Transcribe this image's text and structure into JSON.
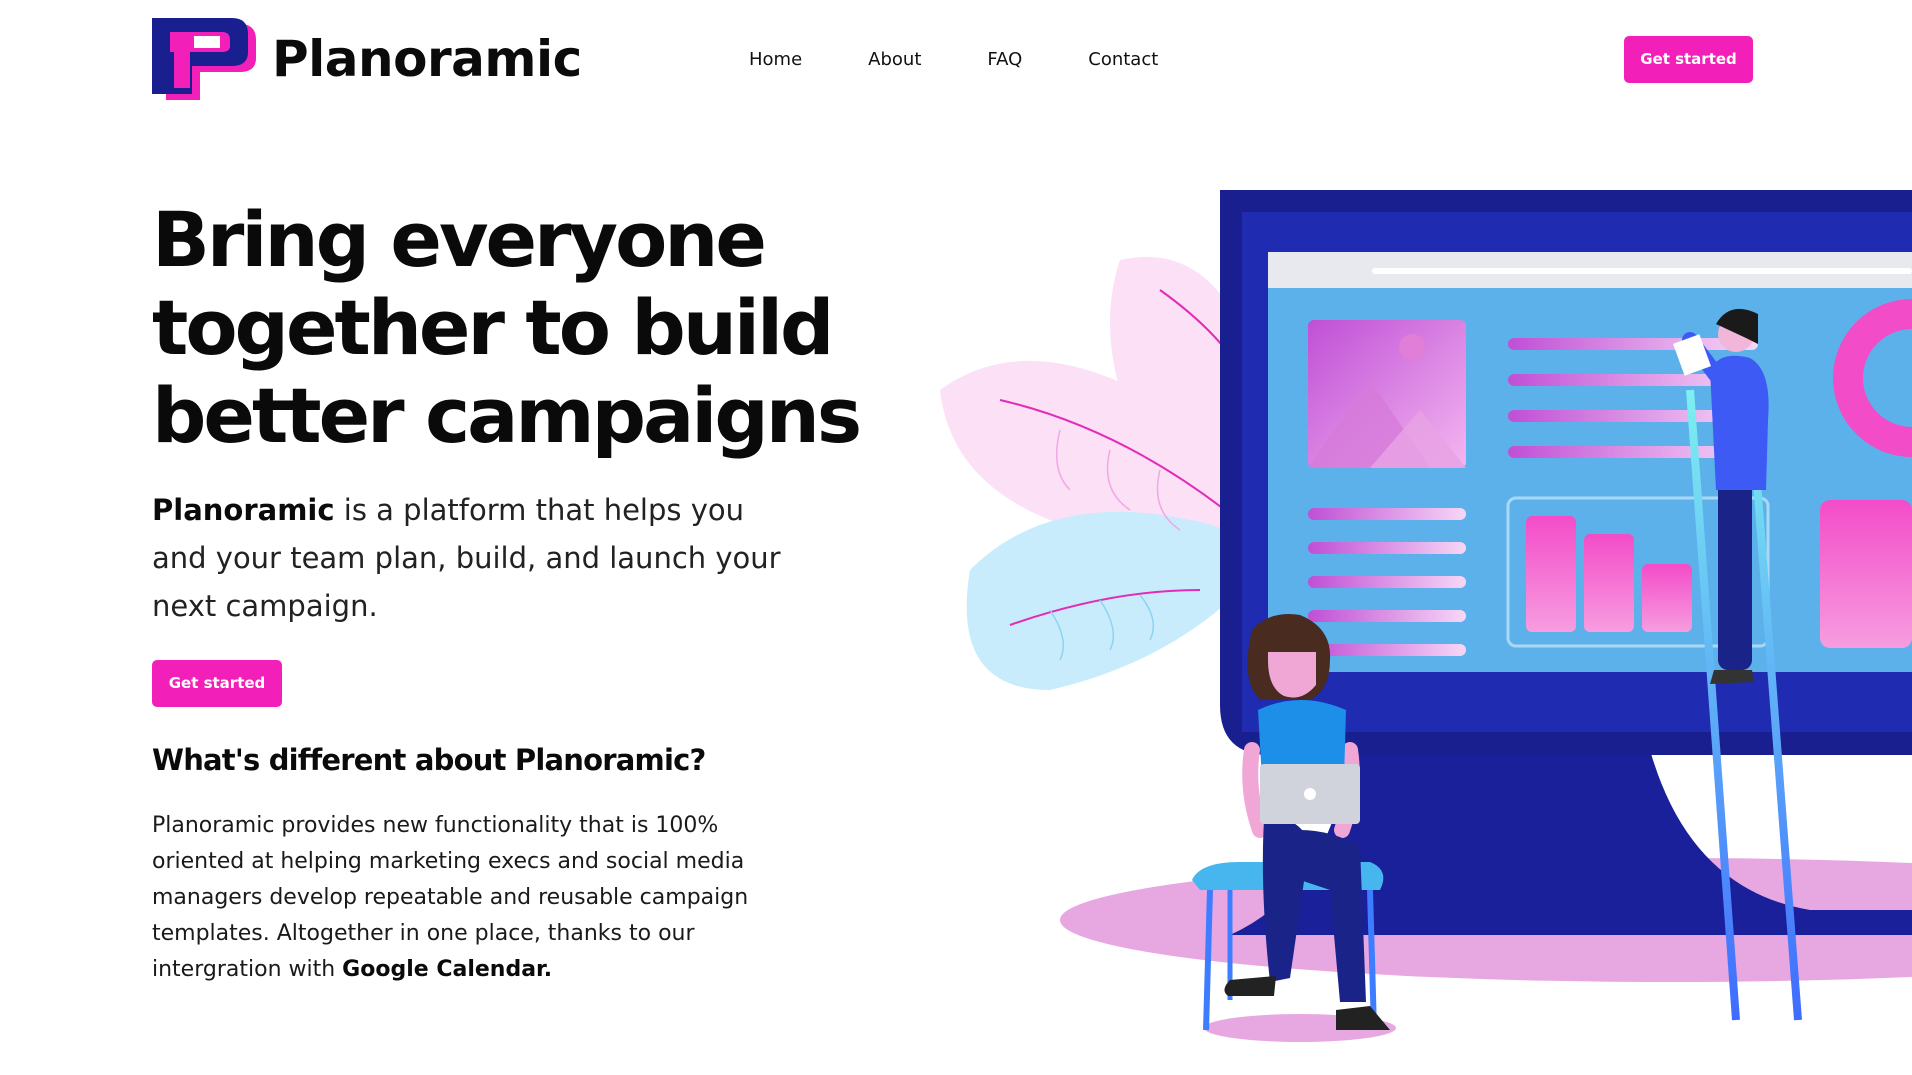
{
  "brand": {
    "name": "Planoramic",
    "logo_letter": "P",
    "colors": {
      "primary": "#f21fb8",
      "navy": "#1a1f8f",
      "text": "#0a0a0a"
    }
  },
  "nav": {
    "items": [
      {
        "label": "Home"
      },
      {
        "label": "About"
      },
      {
        "label": "FAQ"
      },
      {
        "label": "Contact"
      }
    ]
  },
  "header": {
    "cta_label": "Get started"
  },
  "hero": {
    "title": "Bring everyone together to build better campaigns",
    "lead_brand": "Planoramic",
    "lead_rest": " is a platform that helps you and your team plan, build, and launch your next campaign.",
    "cta_label": "Get started"
  },
  "features": {
    "title": "What's different about Planoramic?",
    "body": "Planoramic provides new functionality that is 100% oriented at helping marketing execs and social media managers develop repeatable and reusable campaign templates. Altogether in one place, thanks to our intergration with ",
    "body_highlight": "Google Calendar."
  },
  "illustration": {
    "icons": [
      "leaf-decoration",
      "monitor",
      "image-icon",
      "bar-chart-icon",
      "donut-chart-icon",
      "ladder",
      "person-standing",
      "person-sitting-laptop"
    ]
  }
}
